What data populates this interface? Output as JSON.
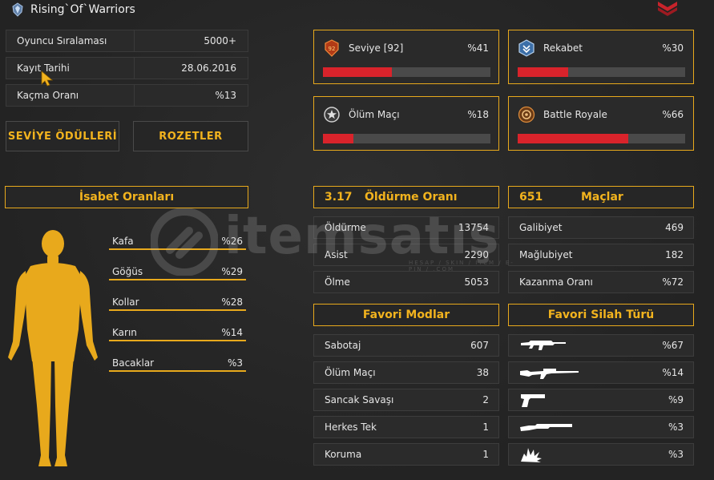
{
  "player": {
    "name": "Rising`Of`Warriors"
  },
  "info": [
    {
      "label": "Oyuncu Sıralaması",
      "value": "5000+"
    },
    {
      "label": "Kayıt Tarihi",
      "value": "28.06.2016"
    },
    {
      "label": "Kaçma Oranı",
      "value": "%13"
    }
  ],
  "buttons": {
    "level_rewards": "SEVİYE ÖDÜLLERİ",
    "badges": "ROZETLER"
  },
  "modes": [
    {
      "name": "Seviye [92]",
      "percent_label": "%41",
      "fill": 0.41,
      "icon": "level-badge-icon"
    },
    {
      "name": "Rekabet",
      "percent_label": "%30",
      "fill": 0.3,
      "icon": "competitive-icon"
    },
    {
      "name": "Ölüm Maçı",
      "percent_label": "%18",
      "fill": 0.18,
      "icon": "deathmatch-icon"
    },
    {
      "name": "Battle Royale",
      "percent_label": "%66",
      "fill": 0.66,
      "icon": "battle-royale-icon"
    }
  ],
  "accuracy": {
    "title": "İsabet Oranları",
    "parts": [
      {
        "label": "Kafa",
        "value": "%26"
      },
      {
        "label": "Göğüs",
        "value": "%29"
      },
      {
        "label": "Kollar",
        "value": "%28"
      },
      {
        "label": "Karın",
        "value": "%14"
      },
      {
        "label": "Bacaklar",
        "value": "%3"
      }
    ]
  },
  "kill_ratio": {
    "value": "3.17",
    "title": "Öldürme Oranı",
    "rows": [
      {
        "label": "Öldürme",
        "value": "13754"
      },
      {
        "label": "Asist",
        "value": "2290"
      },
      {
        "label": "Ölme",
        "value": "5053"
      }
    ]
  },
  "matches": {
    "value": "651",
    "title": "Maçlar",
    "rows": [
      {
        "label": "Galibiyet",
        "value": "469"
      },
      {
        "label": "Mağlubiyet",
        "value": "182"
      },
      {
        "label": "Kazanma Oranı",
        "value": "%72"
      }
    ]
  },
  "favorite_modes": {
    "title": "Favori Modlar",
    "rows": [
      {
        "label": "Sabotaj",
        "value": "607"
      },
      {
        "label": "Ölüm Maçı",
        "value": "38"
      },
      {
        "label": "Sancak Savaşı",
        "value": "2"
      },
      {
        "label": "Herkes Tek",
        "value": "1"
      },
      {
        "label": "Koruma",
        "value": "1"
      }
    ]
  },
  "favorite_weapons": {
    "title": "Favori Silah Türü",
    "rows": [
      {
        "icon": "assault-rifle-icon",
        "value": "%67"
      },
      {
        "icon": "sniper-rifle-icon",
        "value": "%14"
      },
      {
        "icon": "pistol-icon",
        "value": "%9"
      },
      {
        "icon": "shotgun-icon",
        "value": "%3"
      },
      {
        "icon": "grenade-icon",
        "value": "%3"
      }
    ]
  },
  "watermark": {
    "text": "itemsatış",
    "sub": "HESAP / SKIN / ITEM / E-PIN / .COM"
  },
  "colors": {
    "accent": "#e8a91c",
    "gold_text": "#f2b31e",
    "bar_fill": "#d9232b",
    "bar_track": "#4a4a4a"
  }
}
